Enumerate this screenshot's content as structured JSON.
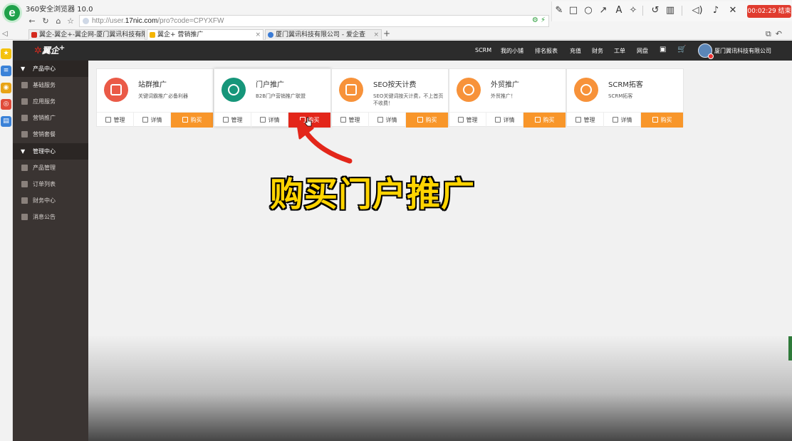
{
  "browser": {
    "title": "360安全浏览器 10.0",
    "url_prefix": "http://user.",
    "url_host": "17nic.com",
    "url_path": "/pro?code=CPYXFW",
    "tabs": [
      {
        "label": "翼企-翼企+-翼企网-厦门翼讯科技有限",
        "active": false,
        "color": "#d42a1e"
      },
      {
        "label": "翼企+ 营销推广",
        "active": true,
        "color": "#f4b400"
      },
      {
        "label": "厦门翼讯科技有限公司 - 爱企查",
        "active": false,
        "color": "#3a7bd5"
      }
    ]
  },
  "recorder": {
    "timer": "00:02:29 结束"
  },
  "app": {
    "logo_text": "翼企",
    "logo_sup": "+",
    "topnav": [
      "SCRM",
      "我的小铺",
      "排名报表",
      "充值",
      "财务",
      "工单",
      "网盘"
    ],
    "company": "厦门翼讯科技有限公司",
    "sidebar": {
      "sections": [
        {
          "label": "产品中心",
          "items": [
            "基础服务",
            "应用服务",
            "营销推广",
            "营销套餐"
          ]
        },
        {
          "label": "管理中心",
          "items": [
            "产品管理",
            "订单列表",
            "财务中心",
            "消息公告"
          ]
        }
      ]
    },
    "cards": [
      {
        "title": "站群推广",
        "desc": "关键词霸推广必备利器",
        "color": "#ea5a47"
      },
      {
        "title": "门户推广",
        "desc": "B2B门户营销推广联盟",
        "color": "#16967a"
      },
      {
        "title": "SEO按天计费",
        "desc": "SEO关键词按天计费，不上首页不收费！",
        "color": "#f7923a"
      },
      {
        "title": "外贸推广",
        "desc": "外贸推广！",
        "color": "#f7923a"
      },
      {
        "title": "SCRM拓客",
        "desc": "SCRM拓客",
        "color": "#f7923a"
      }
    ],
    "actions": {
      "manage": "管理",
      "detail": "详情",
      "buy": "购买"
    }
  },
  "overlay": {
    "caption": "购买门户推广"
  }
}
